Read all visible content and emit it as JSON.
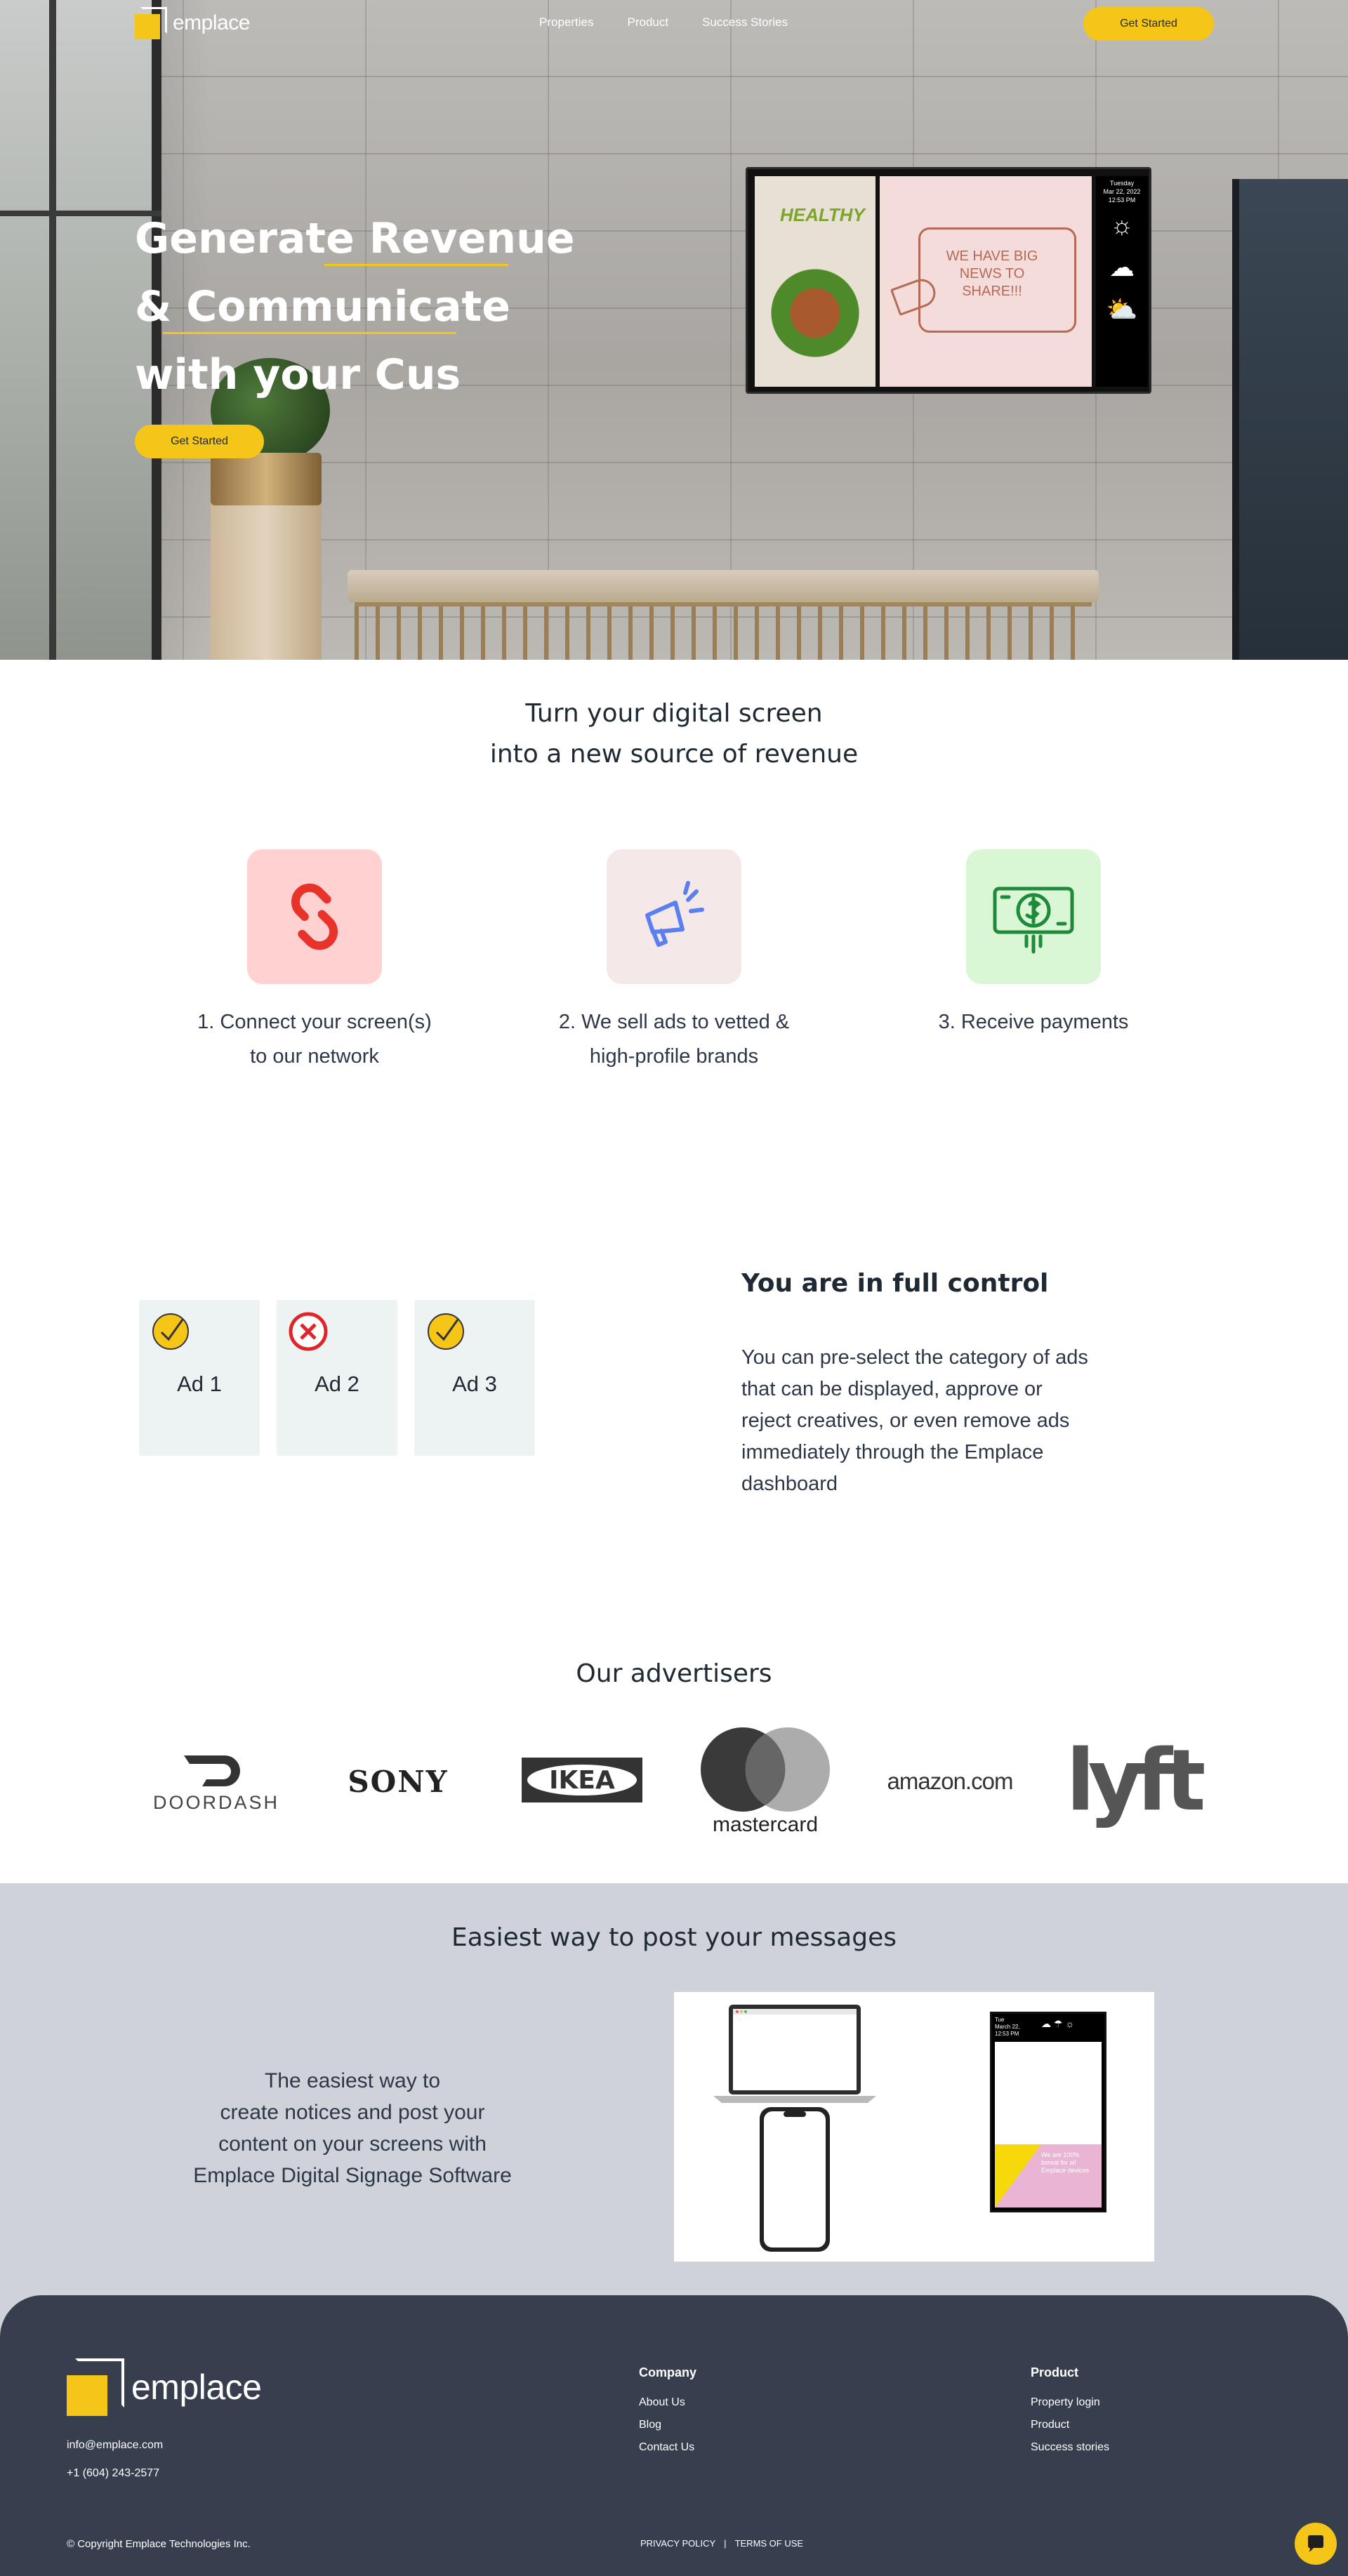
{
  "brand": {
    "name": "emplace",
    "accent": "#f5c518",
    "footer_bg": "#373f4e",
    "section_bg": "#cfd3d9"
  },
  "nav": {
    "links": [
      "Properties",
      "Product",
      "Success Stories"
    ],
    "cta": "Get Started"
  },
  "hero": {
    "title_lines": [
      "Generate Revenue",
      "& Communicate",
      "with your Cus"
    ],
    "cta": "Get Started",
    "screen": {
      "healthy": "HEALTHY",
      "news": "WE HAVE BIG NEWS TO SHARE!!!",
      "date": [
        "Tuesday",
        "Mar 22, 2022",
        "12:53 PM"
      ],
      "weather_icons": [
        "sun-icon",
        "rain-cloud-icon",
        "partly-cloudy-icon"
      ]
    }
  },
  "how": {
    "title_lines": [
      "Turn your digital screen",
      "into a new source of revenue"
    ],
    "steps": [
      {
        "icon": "link-icon",
        "color": "#ffd1d1",
        "lines": [
          "1. Connect your screen(s)",
          "to our network"
        ]
      },
      {
        "icon": "megaphone-icon",
        "color": "#f4e9e8",
        "lines": [
          "2. We sell ads to vetted &",
          "high-profile brands"
        ]
      },
      {
        "icon": "money-icon",
        "color": "#d9f7d4",
        "lines": [
          "3. Receive payments"
        ]
      }
    ]
  },
  "control": {
    "ads": [
      {
        "label": "Ad 1",
        "status": "approved"
      },
      {
        "label": "Ad 2",
        "status": "rejected"
      },
      {
        "label": "Ad 3",
        "status": "approved"
      }
    ],
    "heading": "You are in full control",
    "body": "You can pre-select the category of ads that can be displayed, approve or reject creatives, or even remove ads immediately through the Emplace dashboard"
  },
  "advertisers": {
    "title": "Our advertisers",
    "logos": [
      "DOORDASH",
      "SONY",
      "IKEA",
      "mastercard",
      "amazon.com",
      "lyft"
    ]
  },
  "post": {
    "title": "Easiest way to post your messages",
    "body_lines": [
      "The easiest way to",
      "create notices and post your",
      "content on your screens with",
      "Emplace Digital Signage Software"
    ],
    "phone_screen": {
      "date": [
        "Tue",
        "March 22,",
        "12:53 PM"
      ],
      "message": "We are 100% boreal for all Emplace devices"
    }
  },
  "footer": {
    "email": "info@emplace.com",
    "phone": "+1 (604) 243-2577",
    "company": {
      "heading": "Company",
      "links": [
        "About Us",
        "Blog",
        "Contact Us"
      ]
    },
    "product": {
      "heading": "Product",
      "links": [
        "Property login",
        "Product",
        "Success stories"
      ]
    },
    "copyright": "© Copyright  Emplace Technologies Inc.",
    "privacy": "PRIVACY POLICY",
    "separator": "|",
    "terms": "TERMS OF USE"
  }
}
